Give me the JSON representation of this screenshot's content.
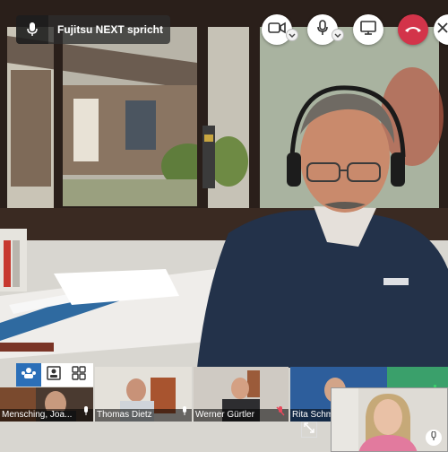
{
  "speaking_indicator": {
    "icon": "microphone-icon",
    "text": "Fujitsu NEXT spricht"
  },
  "controls": {
    "camera": "video-camera-icon",
    "microphone": "microphone-icon",
    "share_screen": "monitor-icon",
    "hang_up": "hang-up-icon",
    "close": "close-icon",
    "hangup_color": "#d3344a"
  },
  "layout_buttons": {
    "items": [
      "participants-icon",
      "speaker-view-icon",
      "gallery-grid-icon"
    ],
    "active_index": 0,
    "active_color": "#2b6fb8"
  },
  "participants": [
    {
      "name": "Mensching, Joa..."
    },
    {
      "name": "Thomas Dietz"
    },
    {
      "name": "Werner Gürtler"
    },
    {
      "name": "Rita Schm..."
    }
  ],
  "self_view": {
    "microphone": "microphone-icon"
  },
  "expand_button": "expand-icon"
}
